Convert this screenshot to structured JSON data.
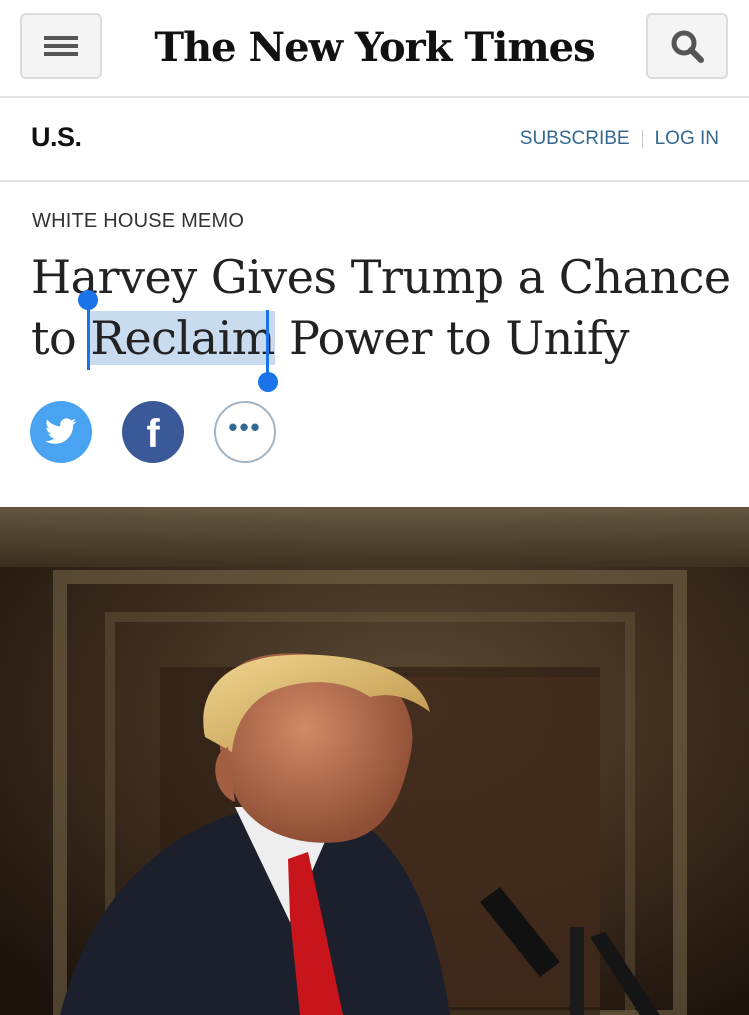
{
  "header": {
    "logo_text": "The New York Times",
    "menu_icon": "hamburger-menu-icon",
    "search_icon": "search-icon"
  },
  "section_bar": {
    "section_name": "U.S.",
    "subscribe_label": "SUBSCRIBE",
    "login_label": "LOG IN"
  },
  "article": {
    "kicker": "WHITE HOUSE MEMO",
    "headline_before": "Harvey Gives Trump a Chance to ",
    "headline_selected": "Reclaim",
    "headline_after": " Power to Unify",
    "share": {
      "twitter_icon": "twitter-bird-icon",
      "facebook_icon": "facebook-icon",
      "more_icon": "more-dots-icon",
      "facebook_glyph": "f",
      "more_glyph": "•••"
    }
  },
  "colors": {
    "link": "#326891",
    "selection": "#c9dbef",
    "selection_handle": "#1a73e8",
    "twitter": "#4aa3f0",
    "facebook": "#3b5998"
  }
}
